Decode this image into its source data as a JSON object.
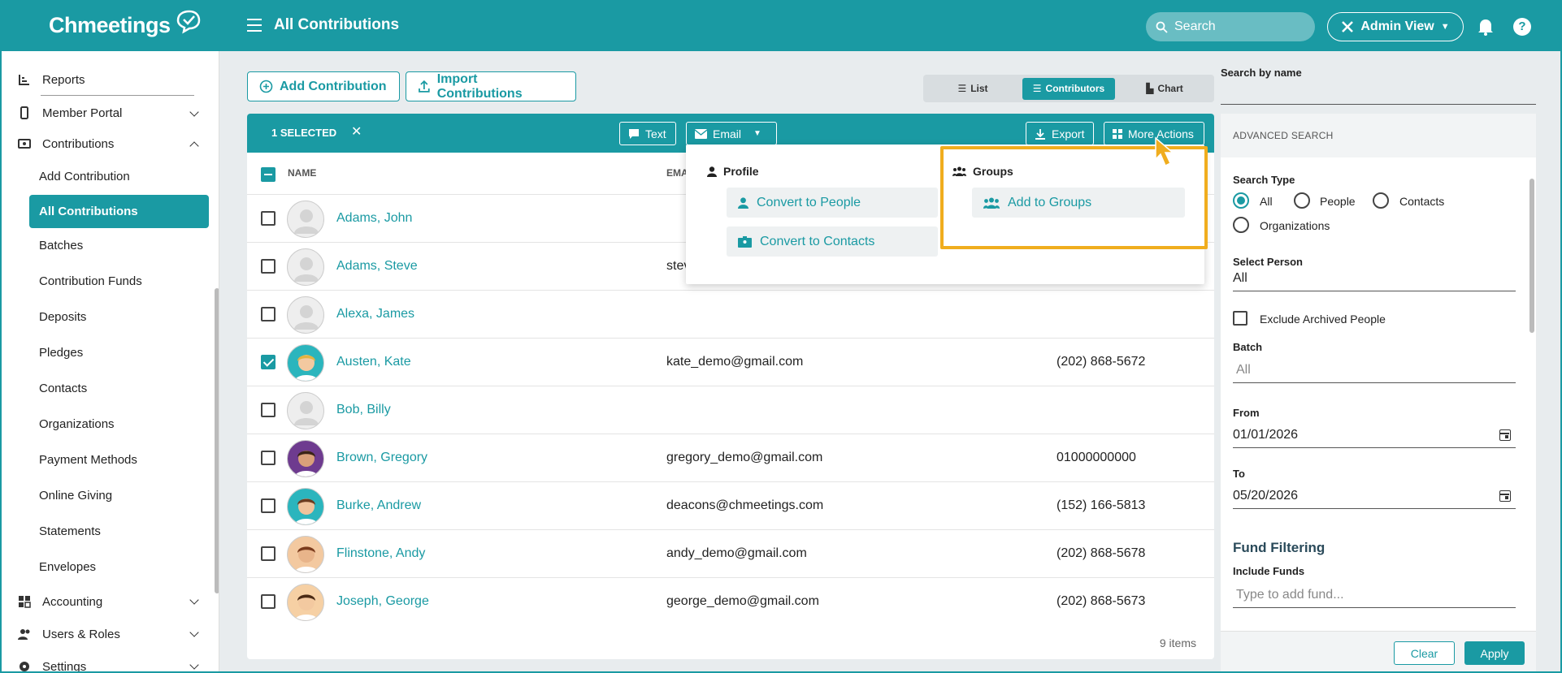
{
  "header": {
    "logo_text": "Chmeetings",
    "page_title": "All Contributions",
    "search_placeholder": "Search",
    "admin_view_label": "Admin View"
  },
  "sidebar": {
    "reports": "Reports",
    "member_portal": "Member Portal",
    "contributions": "Contributions",
    "sub_items": [
      "Add Contribution",
      "All Contributions",
      "Batches",
      "Contribution Funds",
      "Deposits",
      "Pledges",
      "Contacts",
      "Organizations",
      "Payment Methods",
      "Online Giving",
      "Statements",
      "Envelopes"
    ],
    "accounting": "Accounting",
    "users_roles": "Users & Roles",
    "settings": "Settings"
  },
  "toolbar": {
    "add_contribution": "Add Contribution",
    "import_contributions": "Import Contributions",
    "views": [
      "List",
      "Contributors",
      "Chart"
    ],
    "active_view": "Contributors"
  },
  "selection_bar": {
    "selected_label": "1 SELECTED",
    "text_btn": "Text",
    "email_btn": "Email",
    "export_btn": "Export",
    "more_actions_btn": "More Actions"
  },
  "table": {
    "headers": {
      "name": "NAME",
      "email": "EMA"
    },
    "rows": [
      {
        "name": "Adams, John",
        "email": "",
        "phone": "",
        "checked": false
      },
      {
        "name": "Adams, Steve",
        "email": "stev",
        "phone": "",
        "checked": false
      },
      {
        "name": "Alexa, James",
        "email": "",
        "phone": "",
        "checked": false
      },
      {
        "name": "Austen, Kate",
        "email": "kate_demo@gmail.com",
        "phone": "(202) 868-5672",
        "checked": true
      },
      {
        "name": "Bob, Billy",
        "email": "",
        "phone": "",
        "checked": false
      },
      {
        "name": "Brown, Gregory",
        "email": "gregory_demo@gmail.com",
        "phone": "01000000000",
        "checked": false
      },
      {
        "name": "Burke, Andrew",
        "email": "deacons@chmeetings.com",
        "phone": "(152) 166-5813",
        "checked": false
      },
      {
        "name": "Flinstone, Andy",
        "email": "andy_demo@gmail.com",
        "phone": "(202) 868-5678",
        "checked": false
      },
      {
        "name": "Joseph, George",
        "email": "george_demo@gmail.com",
        "phone": "(202) 868-5673",
        "checked": false
      }
    ],
    "items_count": "9 items"
  },
  "dropdown": {
    "profile_heading": "Profile",
    "convert_people": "Convert to People",
    "convert_contacts": "Convert to Contacts",
    "groups_heading": "Groups",
    "add_to_groups": "Add to Groups"
  },
  "right_panel": {
    "search_by_name_label": "Search by name",
    "advanced_search": "ADVANCED SEARCH",
    "search_type_label": "Search Type",
    "search_types": [
      "All",
      "People",
      "Contacts",
      "Organizations"
    ],
    "selected_search_type": "All",
    "select_person_label": "Select Person",
    "select_person_value": "All",
    "exclude_archived": "Exclude Archived People",
    "batch_label": "Batch",
    "batch_value": "All",
    "from_label": "From",
    "from_value": "01/01/2026",
    "to_label": "To",
    "to_value": "05/20/2026",
    "fund_filtering": "Fund Filtering",
    "include_funds_label": "Include Funds",
    "include_funds_placeholder": "Type to add fund...",
    "clear_btn": "Clear",
    "apply_btn": "Apply"
  },
  "colors": {
    "brand": "#1a9aa3",
    "highlight": "#f0ad1e"
  }
}
